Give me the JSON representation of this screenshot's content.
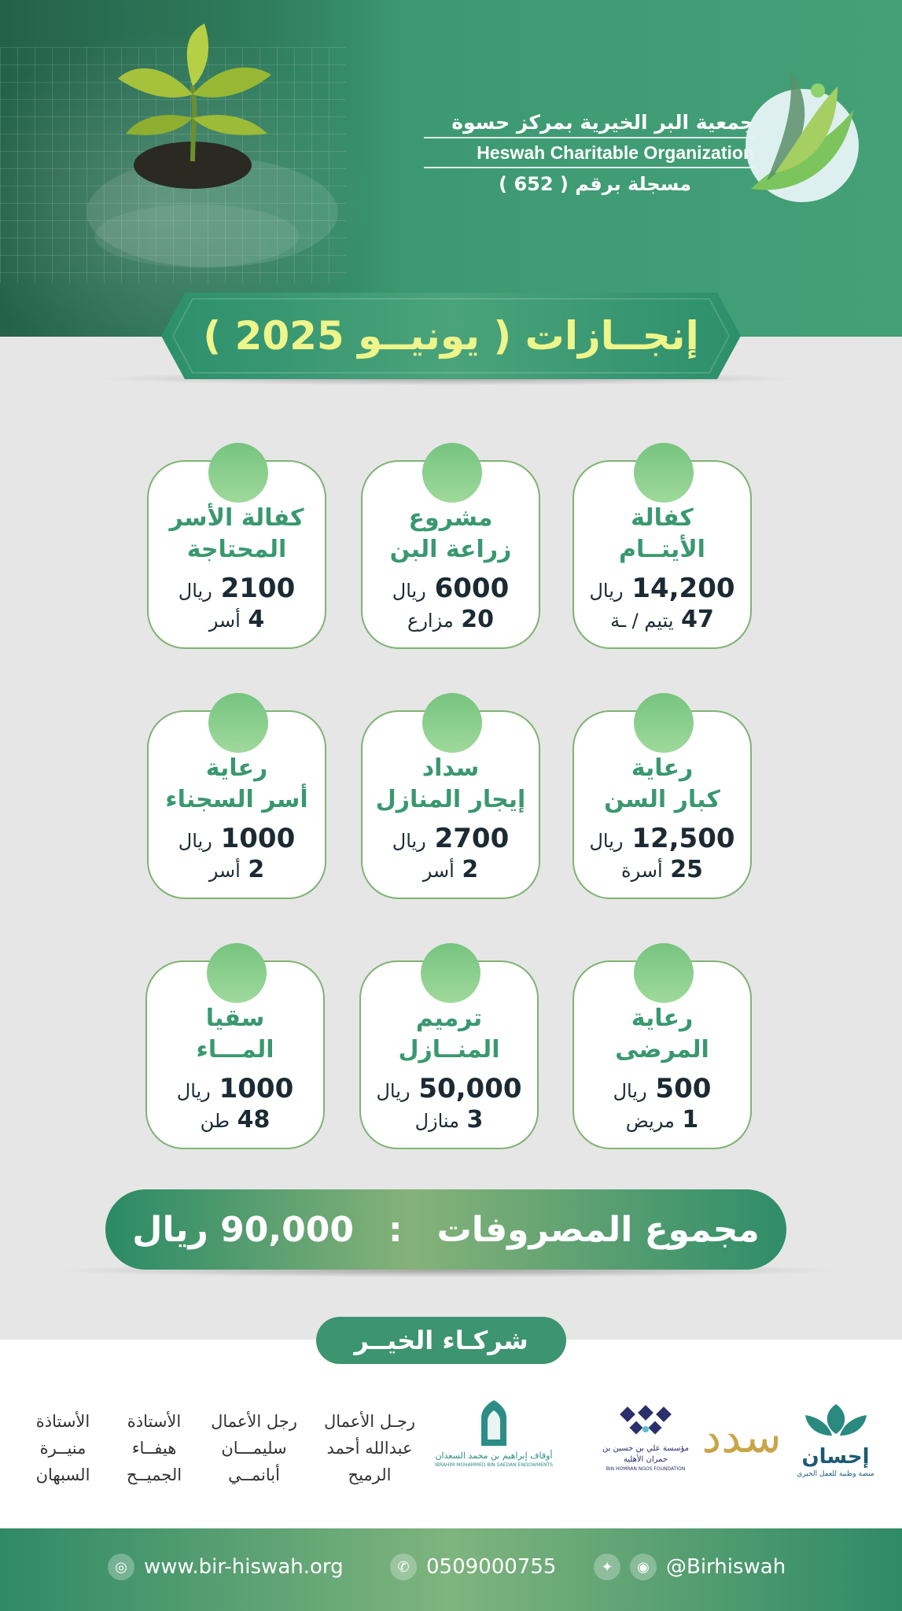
{
  "header": {
    "org_name_ar": "جمعية البر الخيرية بمركز حسوة",
    "org_name_en": "Heswah Charitable Organization",
    "registration": "مسجلة برقم ( 652 )"
  },
  "title": "إنجــازات ( يونيــو 2025 )",
  "cards": [
    {
      "title1": "كفالة",
      "title2": "الأيتــام",
      "amount": "14,200",
      "currency": "ريال",
      "count": "47",
      "count_unit": "يتيم / ـة"
    },
    {
      "title1": "مشروع",
      "title2": "زراعة البن",
      "amount": "6000",
      "currency": "ريال",
      "count": "20",
      "count_unit": "مزارع"
    },
    {
      "title1": "كفالة الأسر",
      "title2": "المحتاجة",
      "amount": "2100",
      "currency": "ريال",
      "count": "4",
      "count_unit": "أسر"
    },
    {
      "title1": "رعاية",
      "title2": "كبار السن",
      "amount": "12,500",
      "currency": "ريال",
      "count": "25",
      "count_unit": "أسرة"
    },
    {
      "title1": "سداد",
      "title2": "إيجار المنازل",
      "amount": "2700",
      "currency": "ريال",
      "count": "2",
      "count_unit": "أسر"
    },
    {
      "title1": "رعاية",
      "title2": "أسر السجناء",
      "amount": "1000",
      "currency": "ريال",
      "count": "2",
      "count_unit": "أسر"
    },
    {
      "title1": "رعاية",
      "title2": "المرضى",
      "amount": "500",
      "currency": "ريال",
      "count": "1",
      "count_unit": "مريض"
    },
    {
      "title1": "ترميم",
      "title2": "المنــازل",
      "amount": "50,000",
      "currency": "ريال",
      "count": "3",
      "count_unit": "منازل"
    },
    {
      "title1": "سقيا",
      "title2": "المـــاء",
      "amount": "1000",
      "currency": "ريال",
      "count": "48",
      "count_unit": "طن"
    }
  ],
  "total": {
    "label": "مجموع المصروفات",
    "separator": ":",
    "value": "90,000 ريال"
  },
  "partners": {
    "title": "شركـاء الخيــر",
    "logo_ihsan": "إحسان",
    "logo_ihsan_sub": "منصة وطنية للعمل الخيري",
    "logo_sadad": "سدد",
    "logo_foundation_sub": "BIN HOMRAN NGOS FOUNDATION",
    "logo_foundation_ar": "مؤسسة علي بن حسين بن حمران الأهلية",
    "logo_awqaf_ar": "أوقاف إبراهيم بن محمد السعدان",
    "logo_awqaf_en": "IBRAHIM MOHAMMED BIN SAEDAN ENDOWMENTS",
    "people": [
      {
        "l1": "رجـل الأعمال",
        "l2": "عبدالله أحمد",
        "l3": "الرميح"
      },
      {
        "l1": "رجل الأعمال",
        "l2": "سليمـــان",
        "l3": "أبانمــي"
      },
      {
        "l1": "الأستاذة",
        "l2": "هيفــاء",
        "l3": "الجميــح"
      },
      {
        "l1": "الأستاذة",
        "l2": "منيــرة",
        "l3": "السبهان"
      }
    ]
  },
  "footer": {
    "website": "www.bir-hiswah.org",
    "phone": "0509000755",
    "social": "@Birhiswah"
  },
  "colors": {
    "primary": "#3d9470",
    "accent_text": "#eef58a",
    "card_border": "#7fb373",
    "card_title": "#3a9870"
  }
}
